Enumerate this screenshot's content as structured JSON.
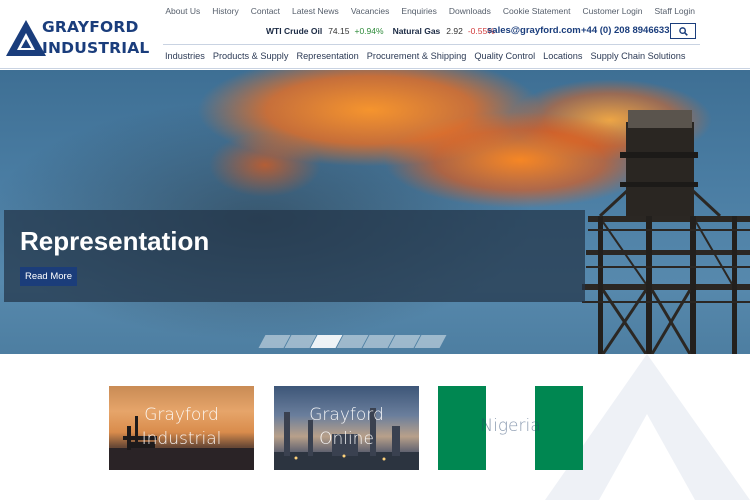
{
  "brand": {
    "name_line1": "GRAYFORD",
    "name_line2": "INDUSTRIAL",
    "color": "#1a3d7c"
  },
  "top_links": [
    "About Us",
    "History",
    "Contact",
    "Latest News",
    "Vacancies",
    "Enquiries",
    "Downloads",
    "Cookie Statement",
    "Customer Login",
    "Staff Login"
  ],
  "ticker": {
    "oil": {
      "name": "WTI Crude Oil",
      "value": "74.15",
      "change": "+0.94%"
    },
    "gas": {
      "name": "Natural Gas",
      "value": "2.92",
      "change": "-0.55%"
    }
  },
  "contact": {
    "email": "sales@grayford.com",
    "phone": "+44 (0) 208 8946633"
  },
  "search": {
    "icon": "search-icon"
  },
  "main_nav": [
    "Industries",
    "Products & Supply",
    "Representation",
    "Procurement & Shipping",
    "Quality Control",
    "Locations",
    "Supply Chain Solutions"
  ],
  "hero": {
    "title": "Representation",
    "button": "Read More",
    "slide_count": 7,
    "active_slide": 3
  },
  "cards": [
    {
      "label_line1": "Grayford",
      "label_line2": "Industrial"
    },
    {
      "label_line1": "Grayford",
      "label_line2": "Online"
    },
    {
      "label_line1": "Nigeria",
      "label_line2": ""
    }
  ],
  "colors": {
    "accent": "#1b3d7a",
    "positive": "#2e8b3a",
    "negative": "#d23b3b",
    "nigeria_green": "#008751"
  }
}
